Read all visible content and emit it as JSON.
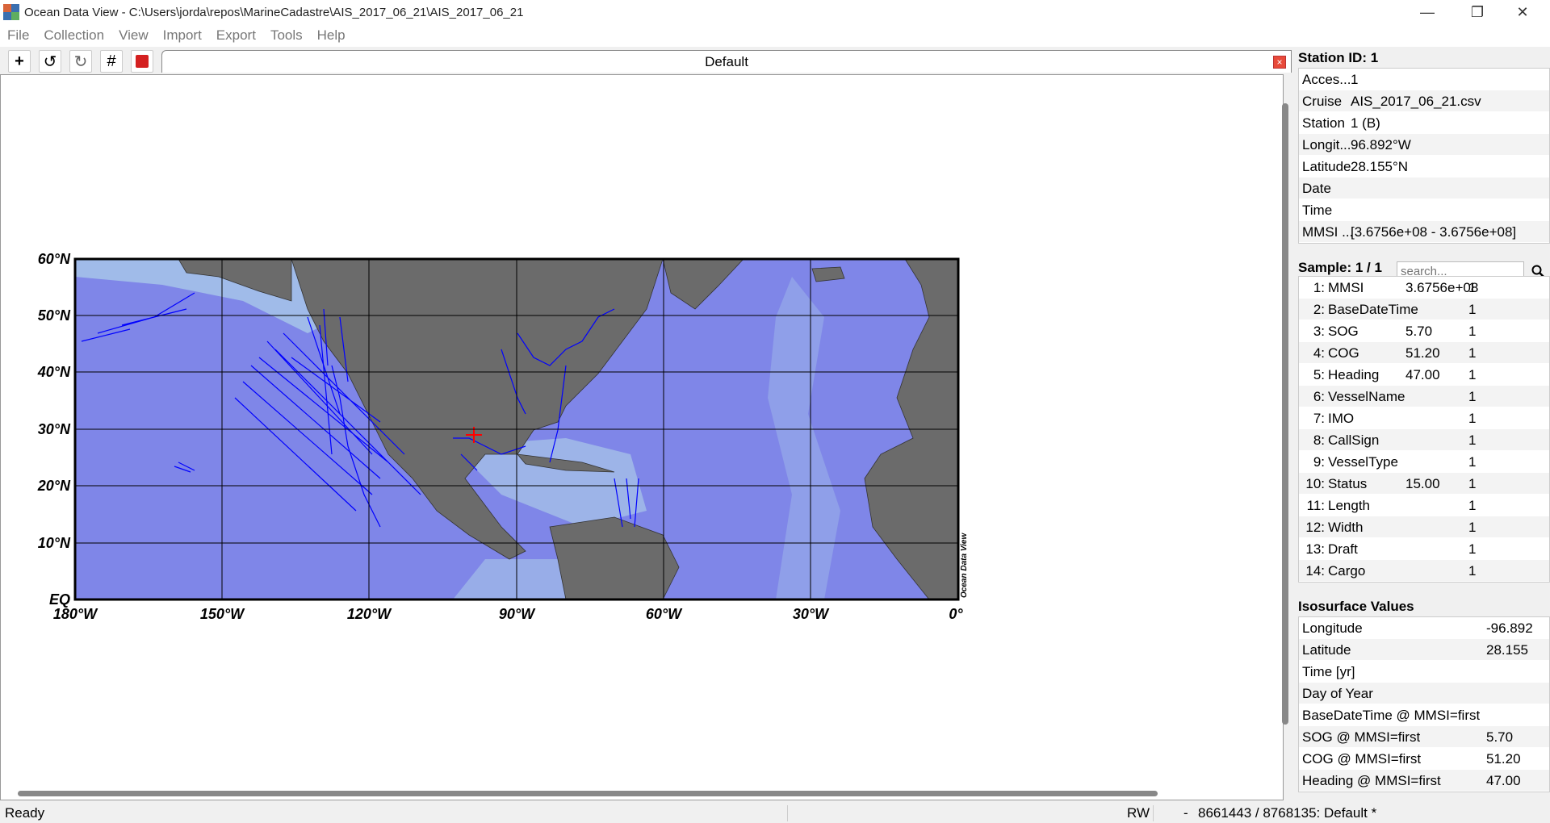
{
  "window": {
    "title": "Ocean Data View - C:\\Users\\jorda\\repos\\MarineCadastre\\AIS_2017_06_21\\AIS_2017_06_21",
    "minimize": "—",
    "restore": "❐",
    "close": "✕"
  },
  "menu": [
    "File",
    "Collection",
    "View",
    "Import",
    "Export",
    "Tools",
    "Help"
  ],
  "toolbar": {
    "add": "+",
    "undo": "↺",
    "redo": "↻",
    "grid": "#",
    "save": "💾"
  },
  "tab": {
    "label": "Default",
    "close": "×"
  },
  "map": {
    "lat_labels": [
      "60°N",
      "50°N",
      "40°N",
      "30°N",
      "20°N",
      "10°N",
      "EQ"
    ],
    "lon_labels": [
      "180°W",
      "150°W",
      "120°W",
      "90°W",
      "60°W",
      "30°W",
      "0°"
    ],
    "watermark": "Ocean Data View",
    "colors": {
      "ocean": "#7f86e8",
      "shelf": "#a9c8e8",
      "land": "#6b6b6b",
      "track": "#0000ff",
      "marker": "#ff0000"
    }
  },
  "station": {
    "header": "Station ID: 1",
    "rows": [
      {
        "k": "Acces...",
        "v": "1"
      },
      {
        "k": "Cruise",
        "v": "AIS_2017_06_21.csv"
      },
      {
        "k": "Station",
        "v": "1 (B)"
      },
      {
        "k": "Longit...",
        "v": "96.892°W"
      },
      {
        "k": "Latitude",
        "v": "28.155°N"
      },
      {
        "k": "Date",
        "v": ""
      },
      {
        "k": "Time",
        "v": ""
      },
      {
        "k": "MMSI ...",
        "v": "[3.6756e+08 - 3.6756e+08]"
      }
    ]
  },
  "sample": {
    "header": "Sample: 1 / 1",
    "search_placeholder": "search...",
    "rows": [
      {
        "n": "1:",
        "name": "MMSI",
        "v": "3.6756e+08",
        "q": "1"
      },
      {
        "n": "2:",
        "name": "BaseDateTime",
        "v": "",
        "q": "1"
      },
      {
        "n": "3:",
        "name": "SOG",
        "v": "5.70",
        "q": "1"
      },
      {
        "n": "4:",
        "name": "COG",
        "v": "51.20",
        "q": "1"
      },
      {
        "n": "5:",
        "name": "Heading",
        "v": "47.00",
        "q": "1"
      },
      {
        "n": "6:",
        "name": "VesselName",
        "v": "",
        "q": "1"
      },
      {
        "n": "7:",
        "name": "IMO",
        "v": "",
        "q": "1"
      },
      {
        "n": "8:",
        "name": "CallSign",
        "v": "",
        "q": "1"
      },
      {
        "n": "9:",
        "name": "VesselType",
        "v": "",
        "q": "1"
      },
      {
        "n": "10:",
        "name": "Status",
        "v": "15.00",
        "q": "1"
      },
      {
        "n": "11:",
        "name": "Length",
        "v": "",
        "q": "1"
      },
      {
        "n": "12:",
        "name": "Width",
        "v": "",
        "q": "1"
      },
      {
        "n": "13:",
        "name": "Draft",
        "v": "",
        "q": "1"
      },
      {
        "n": "14:",
        "name": "Cargo",
        "v": "",
        "q": "1"
      }
    ]
  },
  "iso": {
    "header": "Isosurface Values",
    "rows": [
      {
        "k": "Longitude",
        "v": "-96.892"
      },
      {
        "k": "Latitude",
        "v": "28.155"
      },
      {
        "k": "Time [yr]",
        "v": ""
      },
      {
        "k": "Day of Year",
        "v": ""
      },
      {
        "k": "BaseDateTime @ MMSI=first",
        "v": ""
      },
      {
        "k": "SOG @ MMSI=first",
        "v": "5.70"
      },
      {
        "k": "COG @ MMSI=first",
        "v": "51.20"
      },
      {
        "k": "Heading @ MMSI=first",
        "v": "47.00"
      }
    ]
  },
  "status": {
    "ready": "Ready",
    "rw": "RW",
    "dash": "-",
    "info": "8661443 / 8768135: Default *"
  }
}
